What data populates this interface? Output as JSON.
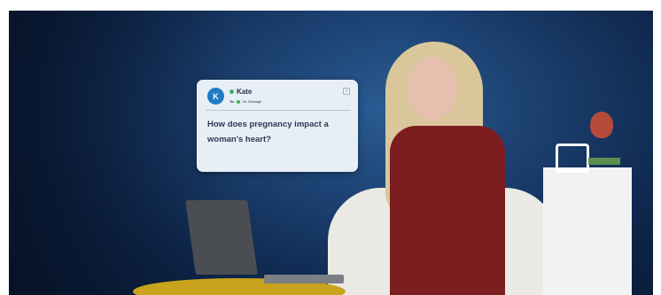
{
  "message_card": {
    "avatar_initial": "K",
    "sender_name": "Kate",
    "to_label": "To:",
    "recipient": "Dr. Murtagh",
    "message": "How does pregnancy impact a woman's heart?"
  },
  "colors": {
    "avatar": "#1f7bc4",
    "online_status": "#3cb15b",
    "card_background": "#e8eef5",
    "backdrop": "#1c4274"
  },
  "icons": {
    "close": "close-icon"
  }
}
